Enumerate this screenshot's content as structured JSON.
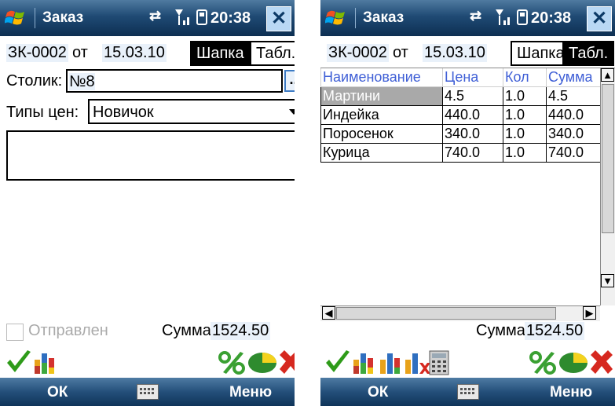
{
  "common": {
    "app_title": "Заказ",
    "time": "20:38",
    "close": "✕",
    "doc_no": "ЗК-0002",
    "from_word": "от",
    "date": "15.03.10",
    "tab_header": "Шапка",
    "tab_table": "Табл.",
    "sum_label": "Сумма:",
    "sum_value": "1524.50",
    "soft_left": "ОК",
    "soft_right": "Меню"
  },
  "left": {
    "table_label": "Столик:",
    "table_value": "№8",
    "ellipsis": "...",
    "price_type_label": "Типы цен:",
    "price_type_value": "Новичок",
    "comment": "",
    "sent_label": "Отправлен",
    "sent_checked": false,
    "active_tab": "Шапка"
  },
  "right": {
    "active_tab": "Табл.",
    "columns": [
      "Наименование",
      "Цена",
      "Кол",
      "Сумма"
    ],
    "rows": [
      [
        "Мартини",
        "4.5",
        "1.0",
        "4.5"
      ],
      [
        "Индейка",
        "440.0",
        "1.0",
        "440.0"
      ],
      [
        "Поросенок",
        "340.0",
        "1.0",
        "340.0"
      ],
      [
        "Курица",
        "740.0",
        "1.0",
        "740.0"
      ]
    ]
  },
  "icons": {
    "ok": "checkmark-icon",
    "chart": "bar-chart-icon",
    "percent": "percent-icon",
    "pie": "pie-chart-icon",
    "cancel": "red-x-icon",
    "calc": "calculator-icon"
  },
  "colors": {
    "title_bar": "#1f4a74",
    "header_text": "#3f5fd6",
    "selected_row": "#a9a9a9"
  }
}
